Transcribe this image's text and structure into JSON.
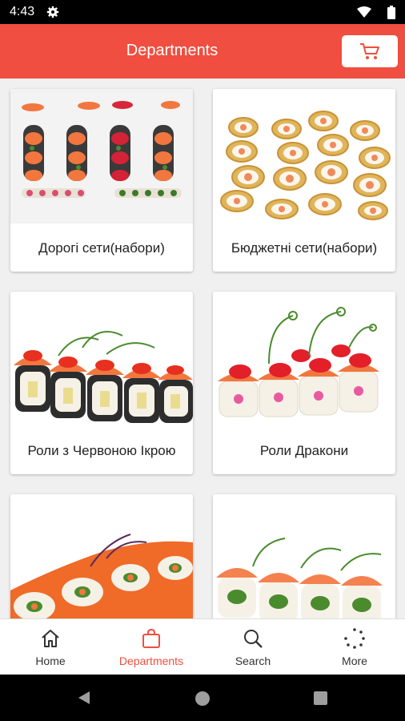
{
  "status": {
    "time": "4:43"
  },
  "header": {
    "title": "Departments"
  },
  "cards": [
    {
      "label": "Дорогі сети(набори)"
    },
    {
      "label": "Бюджетні сети(набори)"
    },
    {
      "label": "Роли з Червоною Ікрою"
    },
    {
      "label": "Роли Дракони"
    },
    {
      "label": ""
    },
    {
      "label": ""
    }
  ],
  "nav": [
    {
      "label": "Home",
      "icon": "home-icon"
    },
    {
      "label": "Departments",
      "icon": "bag-icon"
    },
    {
      "label": "Search",
      "icon": "search-icon"
    },
    {
      "label": "More",
      "icon": "more-icon"
    }
  ],
  "colors": {
    "accent": "#f04e40",
    "salmon": "#f2773f",
    "roe": "#e7301f",
    "rice": "#f6f1e6",
    "nori": "#2d2d2d",
    "green": "#4a8b2e"
  }
}
